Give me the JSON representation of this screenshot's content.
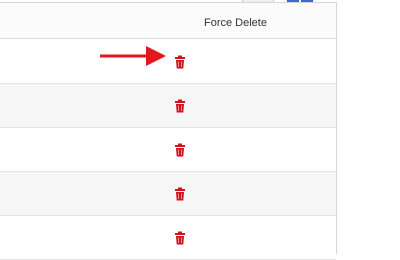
{
  "table": {
    "header": {
      "force_delete_label": "Force Delete"
    },
    "rows": [
      {
        "action_icon": "trash-icon",
        "action_color": "#d0121b"
      },
      {
        "action_icon": "trash-icon",
        "action_color": "#d0121b"
      },
      {
        "action_icon": "trash-icon",
        "action_color": "#d0121b"
      },
      {
        "action_icon": "trash-icon",
        "action_color": "#d0121b"
      },
      {
        "action_icon": "trash-icon",
        "action_color": "#d0121b"
      }
    ]
  },
  "annotation": {
    "type": "arrow",
    "color": "#e3161b",
    "points_to": "first-row-trash-icon"
  },
  "colors": {
    "danger": "#d0121b",
    "accent": "#2f6fd6"
  }
}
